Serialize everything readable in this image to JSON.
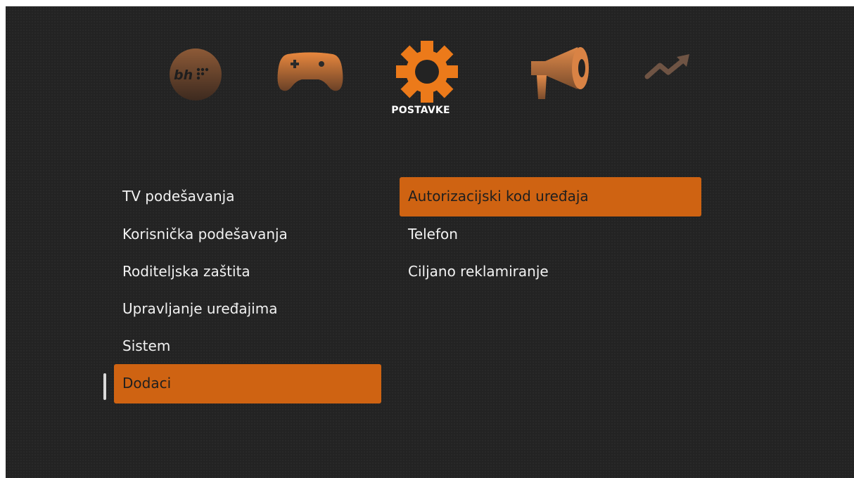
{
  "colors": {
    "background": "#232323",
    "accent": "#cf6312",
    "text": "#f2f2f2",
    "selected_text": "#1f1f1f"
  },
  "top_nav": {
    "items": [
      {
        "icon": "bh-logo-icon",
        "logo_text": "bh",
        "selected": false
      },
      {
        "icon": "gamepad-icon",
        "selected": false
      },
      {
        "icon": "gear-icon",
        "selected": true
      },
      {
        "icon": "megaphone-icon",
        "selected": false
      },
      {
        "icon": "trending-up-icon",
        "selected": false
      }
    ],
    "selected_label": "POSTAVKE"
  },
  "left_menu": {
    "items": [
      {
        "label": "TV podešavanja",
        "selected": false
      },
      {
        "label": "Korisnička podešavanja",
        "selected": false
      },
      {
        "label": "Roditeljska zaštita",
        "selected": false
      },
      {
        "label": "Upravljanje uređajima",
        "selected": false
      },
      {
        "label": "Sistem",
        "selected": false
      },
      {
        "label": "Dodaci",
        "selected": true
      }
    ]
  },
  "right_menu": {
    "items": [
      {
        "label": "Autorizacijski kod uređaja",
        "selected": true
      },
      {
        "label": "Telefon",
        "selected": false
      },
      {
        "label": "Ciljano reklamiranje",
        "selected": false
      }
    ]
  }
}
